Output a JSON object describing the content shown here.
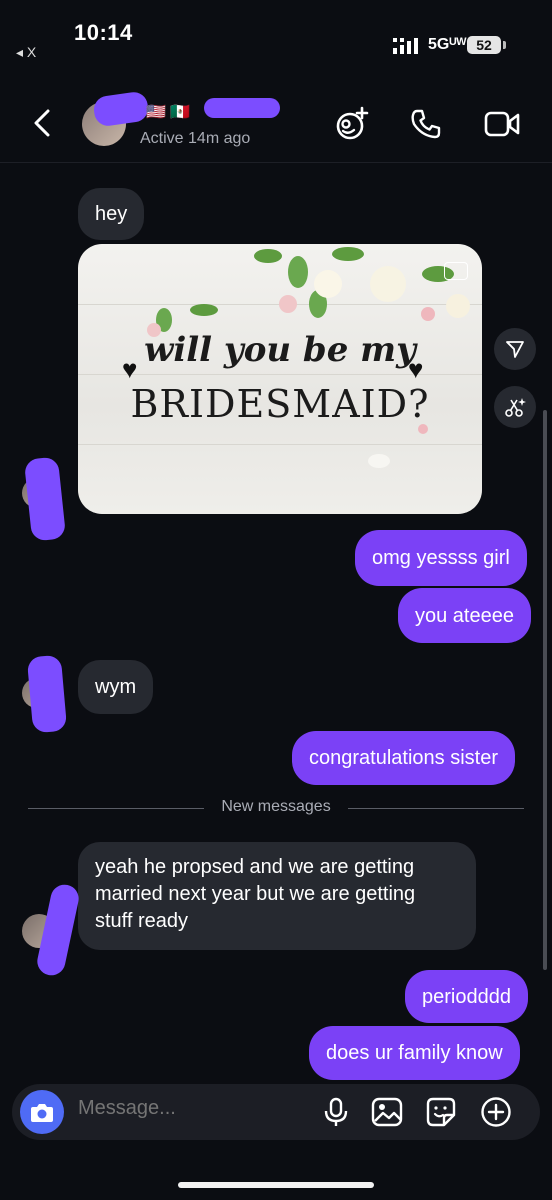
{
  "status_bar": {
    "time": "10:14",
    "back_app": "◂ X",
    "network": "5Gᵁᵂ",
    "battery": "52"
  },
  "header": {
    "flags": "🇺🇸 🇲🇽",
    "active_status": "Active 14m ago"
  },
  "messages": [
    {
      "side": "incoming",
      "text": "hey"
    },
    {
      "side": "incoming",
      "type": "image",
      "card_line1": "will you be my",
      "card_line2": "BRIDESMAID?"
    },
    {
      "side": "outgoing",
      "text": "omg yessss girl"
    },
    {
      "side": "outgoing",
      "text": "you ateeee"
    },
    {
      "side": "incoming",
      "text": "wym"
    },
    {
      "side": "outgoing",
      "text": "congratulations sister"
    },
    {
      "side": "incoming",
      "text": "yeah he propsed and we are getting married next year but we are getting stuff ready",
      "lines": [
        "yeah he propsed and we are getting",
        "married next year but we are getting",
        "stuff ready"
      ]
    },
    {
      "side": "outgoing",
      "text": "periodddd"
    },
    {
      "side": "outgoing",
      "text": "does ur family know"
    }
  ],
  "divider": {
    "label": "New messages"
  },
  "composer": {
    "placeholder": "Message..."
  },
  "icons": {
    "header": [
      "back-chevron-icon",
      "effects-icon",
      "phone-icon",
      "video-camera-icon"
    ],
    "image_actions": [
      "share-icon",
      "sparkle-scissors-icon"
    ],
    "composer": [
      "camera-icon",
      "microphone-icon",
      "gallery-icon",
      "sticker-icon",
      "add-icon"
    ]
  },
  "colors": {
    "background": "#0b0d12",
    "outgoing_bubble": "#7b41f6",
    "incoming_bubble": "#262930",
    "camera_button": "#4f6bf5"
  }
}
